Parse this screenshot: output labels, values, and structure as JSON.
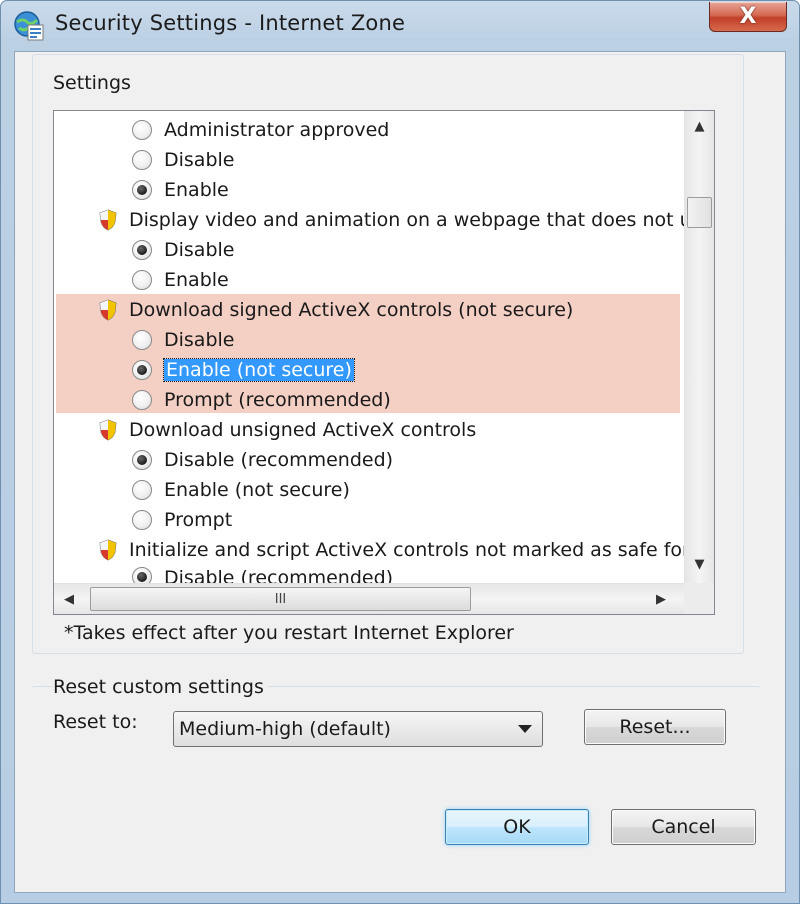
{
  "window": {
    "title": "Security Settings - Internet Zone",
    "close_label": "X"
  },
  "settings": {
    "group_label": "Settings",
    "items": [
      {
        "type": "option",
        "label": "Administrator approved",
        "checked": false
      },
      {
        "type": "option",
        "label": "Disable",
        "checked": false
      },
      {
        "type": "option",
        "label": "Enable",
        "checked": true
      },
      {
        "type": "category",
        "label": "Display video and animation on a webpage that does not use"
      },
      {
        "type": "option",
        "label": "Disable",
        "checked": true
      },
      {
        "type": "option",
        "label": "Enable",
        "checked": false
      },
      {
        "type": "category",
        "label": "Download signed ActiveX controls (not secure)"
      },
      {
        "type": "option",
        "label": "Disable",
        "checked": false
      },
      {
        "type": "option",
        "label": "Enable (not secure)",
        "checked": true,
        "selected": true
      },
      {
        "type": "option",
        "label": "Prompt (recommended)",
        "checked": false
      },
      {
        "type": "category",
        "label": "Download unsigned ActiveX controls"
      },
      {
        "type": "option",
        "label": "Disable (recommended)",
        "checked": true
      },
      {
        "type": "option",
        "label": "Enable (not secure)",
        "checked": false
      },
      {
        "type": "option",
        "label": "Prompt",
        "checked": false
      },
      {
        "type": "category",
        "label": "Initialize and script ActiveX controls not marked as safe for sc"
      },
      {
        "type": "option",
        "label": "Disable (recommended)",
        "checked": true
      }
    ],
    "hscroll_grip": "III",
    "note": "*Takes effect after you restart Internet Explorer"
  },
  "reset": {
    "group_label": "Reset custom settings",
    "reset_to_label": "Reset to:",
    "selected_level": "Medium-high (default)",
    "reset_button": "Reset..."
  },
  "footer": {
    "ok_label": "OK",
    "cancel_label": "Cancel"
  },
  "colors": {
    "highlight": "#f3cfc4",
    "selection": "#3399ff"
  }
}
